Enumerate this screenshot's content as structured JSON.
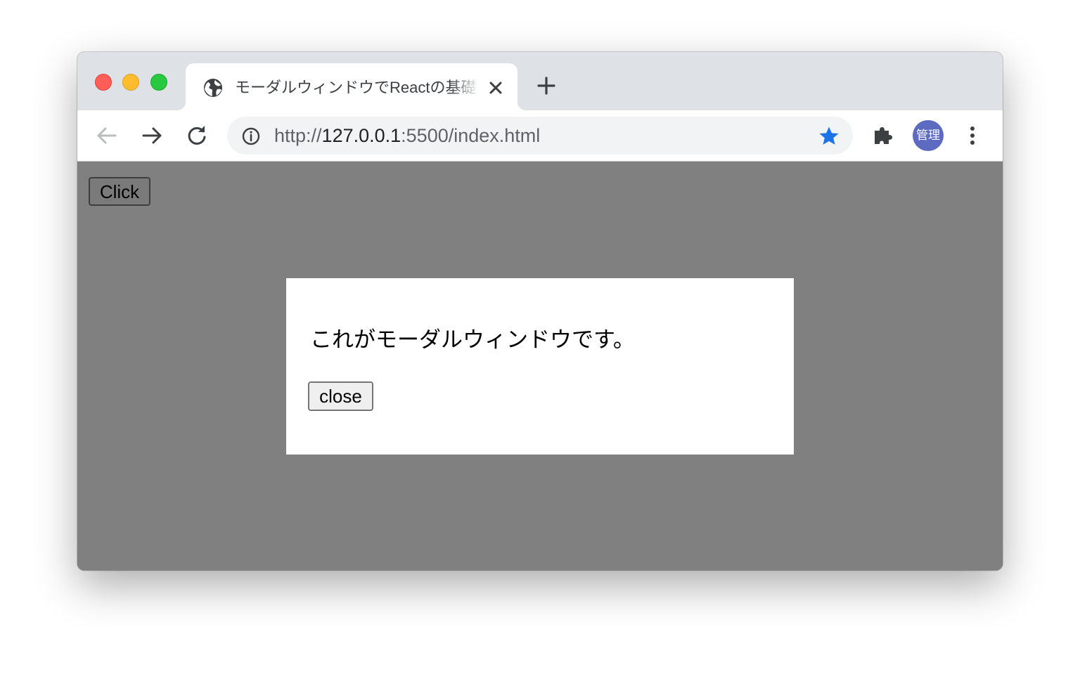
{
  "browser": {
    "tab": {
      "title": "モーダルウィンドウでReactの基礎",
      "favicon": "globe-icon",
      "close_icon": "close-icon"
    },
    "new_tab_icon": "plus-icon",
    "nav": {
      "back_icon": "arrow-left-icon",
      "forward_icon": "arrow-right-icon",
      "reload_icon": "reload-icon"
    },
    "address_bar": {
      "info_icon": "info-icon",
      "url_scheme": "http://",
      "url_host": "127.0.0.1",
      "url_rest": ":5500/index.html",
      "bookmark_icon": "star-icon",
      "bookmark_color": "#1a73e8"
    },
    "extensions_icon": "puzzle-icon",
    "profile": {
      "label": "管理",
      "color": "#5c6bc0"
    },
    "menu_icon": "vertical-dots-icon"
  },
  "page": {
    "background": "#808080",
    "open_button_label": "Click",
    "modal": {
      "message": "これがモーダルウィンドウです。",
      "close_button_label": "close"
    }
  }
}
